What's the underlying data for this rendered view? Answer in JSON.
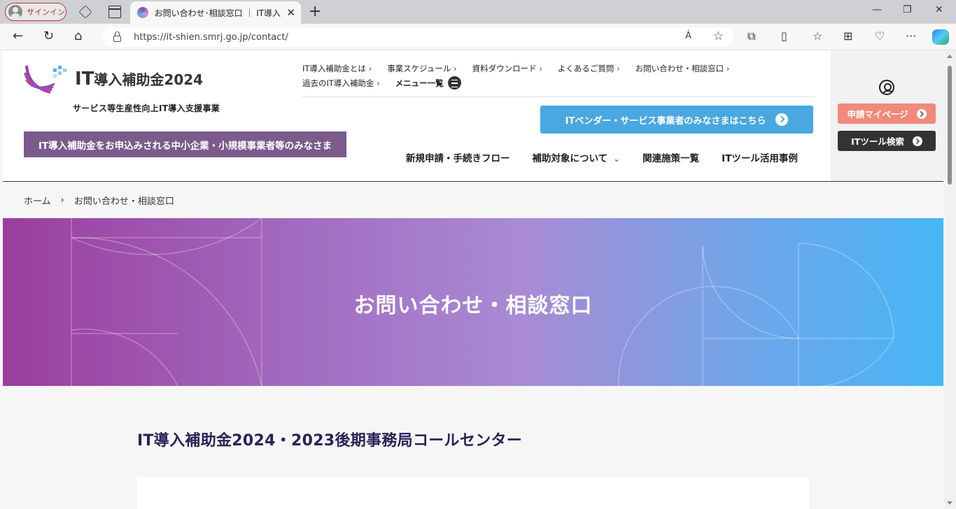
{
  "browser": {
    "signin_label": "サインイン",
    "tab_title": "お問い合わせ･相談窓口 ｜ IT導入補",
    "new_tab": "+",
    "url": "https://it-shien.smrj.go.jp/contact/",
    "read_aloud": "Á",
    "controls": {
      "minimize": "—",
      "restore": "❐",
      "close": "✕"
    }
  },
  "header": {
    "logo_it": "IT",
    "logo_rest": "導入補助金2024",
    "tagline": "サービス等生産性向上IT導入支援事業",
    "smb_button": "IT導入補助金をお申込みされる中小企業・小規模事業者等のみなさま",
    "top_links_row1": [
      "IT導入補助金とは",
      "事業スケジュール",
      "資料ダウンロード",
      "よくあるご質問",
      "お問い合わせ・相談窓口"
    ],
    "top_links_row2": [
      "過去のIT導入補助金"
    ],
    "menu_all": "メニュー一覧",
    "vendor_button": "ITベンダー・サービス事業者のみなさまはこちら",
    "main_nav": [
      "新規申請・手続きフロー",
      "補助対象について",
      "関連施策一覧",
      "ITツール活用事例"
    ]
  },
  "side": {
    "mypage_button": "申請マイページ",
    "tool_search_button": "ITツール検索"
  },
  "breadcrumb": {
    "home": "ホーム",
    "separator": "›",
    "current": "お問い合わせ・相談窓口"
  },
  "hero": {
    "title": "お問い合わせ・相談窓口"
  },
  "content": {
    "section_title": "IT導入補助金2024・2023後期事務局コールセンター"
  }
}
